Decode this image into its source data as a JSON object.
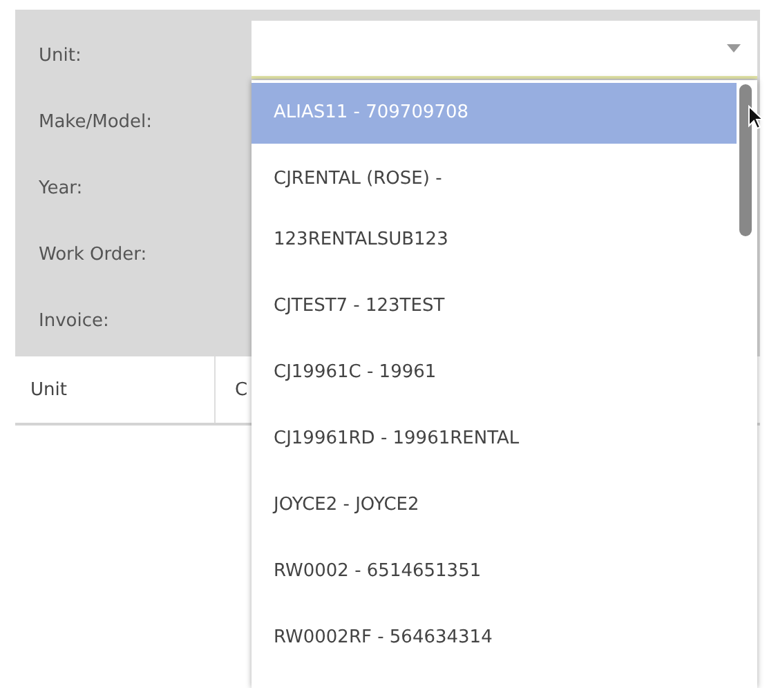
{
  "filters": [
    {
      "label": "Unit:",
      "kind": "select"
    },
    {
      "label": "Make/Model:",
      "kind": "text"
    },
    {
      "label": "Year:",
      "kind": "text"
    },
    {
      "label": "Work Order:",
      "kind": "text"
    },
    {
      "label": "Invoice:",
      "kind": "text"
    }
  ],
  "unit_dropdown": {
    "expanded": true,
    "options": [
      {
        "label": "ALIAS11 - 709709708",
        "selected": true
      },
      {
        "label": "CJRENTAL (ROSE) - 123RENTALSUB123",
        "selected": false
      },
      {
        "label": "CJTEST7 - 123TEST",
        "selected": false
      },
      {
        "label": "CJ19961C - 19961",
        "selected": false
      },
      {
        "label": "CJ19961RD - 19961RENTAL",
        "selected": false
      },
      {
        "label": "JOYCE2 - JOYCE2",
        "selected": false
      },
      {
        "label": "RW0002 - 6514651351",
        "selected": false
      },
      {
        "label": "RW0002RF - 564634314",
        "selected": false
      }
    ]
  },
  "table": {
    "columns": [
      "Unit",
      "C"
    ]
  }
}
